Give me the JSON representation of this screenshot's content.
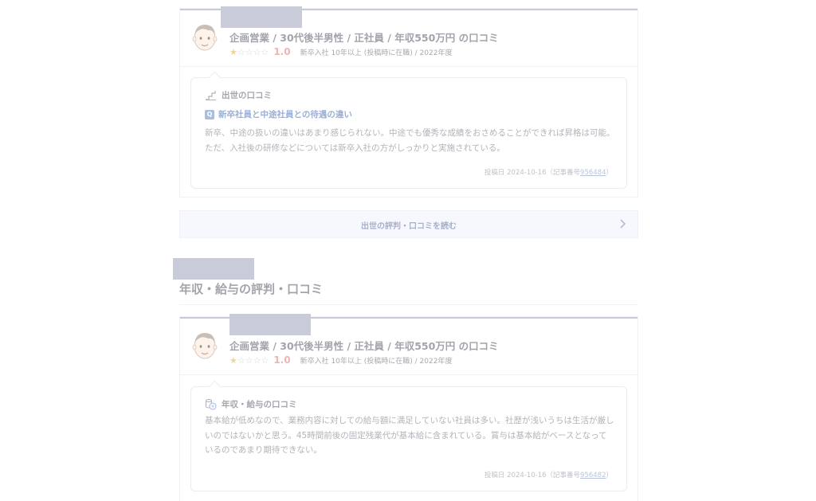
{
  "reviews": [
    {
      "title": "企画営業 / 30代後半男性 / 正社員 / 年収550万円 の口コミ",
      "stars": "★☆☆☆☆",
      "rating": "1.0",
      "meta": "新卒入社 10年以上 (投稿時に在職) / 2022年度",
      "category_icon": "ladder-icon",
      "category": "出世の口コミ",
      "question_badge": "Q",
      "question": "新卒社員と中途社員との待遇の違い",
      "body": "新卒、中途の扱いの違いはあまり感じられない。中途でも優秀な成績をおさめることができれば昇格は可能。ただ、入社後の研修などについては新卒入社の方がしっかりと実施されている。",
      "posted_prefix": "投稿日 2024-10-16（記事番号",
      "article_no": "956484",
      "posted_suffix": "）"
    },
    {
      "title": "企画営業 / 30代後半男性 / 正社員 / 年収550万円 の口コミ",
      "stars": "★☆☆☆☆",
      "rating": "1.0",
      "meta": "新卒入社 10年以上 (投稿時に在職) / 2022年度",
      "category_icon": "coins-icon",
      "category": "年収・給与の口コミ",
      "body": "基本給が低めなので、業務内容に対しての給与額に満足していない社員は多い。社歴が浅いうちは生活が厳しいのではないかと思う。45時間前後の固定残業代が基本給に含まれている。賞与は基本給がベースとなっているのであまり期待できない。",
      "posted_prefix": "投稿日 2024-10-16（記事番号",
      "article_no": "956482",
      "posted_suffix": "）"
    }
  ],
  "read_more": {
    "label": "出世の評判・口コミを読む",
    "icon": "chevron-right-icon"
  },
  "section": {
    "heading": "年収・給与の評判・口コミ"
  },
  "colors": {
    "accent_link": "#9bb0d6",
    "rating": "#efb4b4",
    "star_on": "#f0d49a",
    "redaction": "#c9cbd8"
  }
}
